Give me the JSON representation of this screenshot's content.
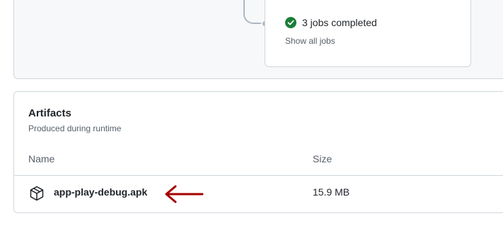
{
  "workflow": {
    "jobs_status": "3 jobs completed",
    "show_all_label": "Show all jobs",
    "status_color": "#1a7f37"
  },
  "artifacts": {
    "title": "Artifacts",
    "subtitle": "Produced during runtime",
    "columns": {
      "name": "Name",
      "size": "Size"
    },
    "items": [
      {
        "name": "app-play-debug.apk",
        "size": "15.9 MB",
        "icon": "package-icon"
      }
    ],
    "annotation": {
      "icon": "red-arrow-icon",
      "color": "#a50000"
    }
  }
}
